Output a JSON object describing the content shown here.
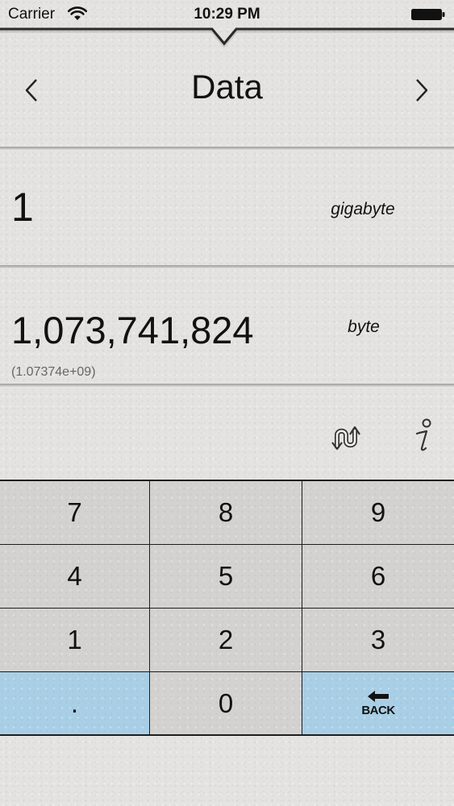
{
  "status_bar": {
    "carrier": "Carrier",
    "time": "10:29 PM",
    "wifi_icon": "wifi-icon",
    "battery_icon": "battery-full-icon"
  },
  "header": {
    "title": "Data",
    "prev_icon": "chevron-left-icon",
    "next_icon": "chevron-right-icon"
  },
  "input": {
    "value": "1",
    "unit": "gigabyte"
  },
  "output": {
    "value": "1,073,741,824",
    "scientific": "(1.07374e+09)",
    "unit": "byte"
  },
  "actions": {
    "swap_icon": "swap-units-icon",
    "info_icon": "info-icon"
  },
  "keypad": {
    "keys": [
      "7",
      "8",
      "9",
      "4",
      "5",
      "6",
      "1",
      "2",
      "3",
      ".",
      "0"
    ],
    "back_label": "BACK",
    "back_icon": "back-arrow-icon"
  },
  "colors": {
    "accent_key": "#a9cfe6",
    "key_background": "#d3d2d0",
    "paper_background": "#e4e3e1",
    "key_grid_lines": "#1d1d1d"
  }
}
